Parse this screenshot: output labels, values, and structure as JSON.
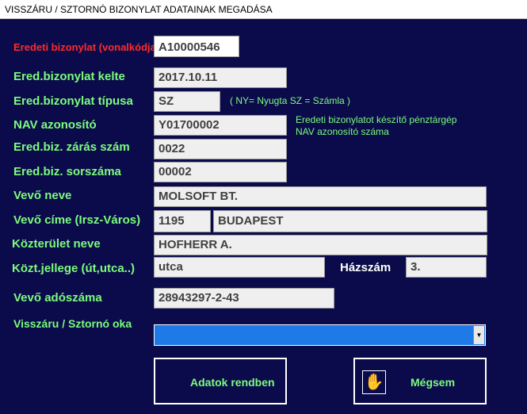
{
  "window": {
    "title": "VISSZÁRU / SZTORNÓ  BIZONYLAT ADATAINAK MEGADÁSA"
  },
  "colors": {
    "background": "#0b0b4b",
    "label": "#7cfc7c",
    "accent_red": "#ff2a2a",
    "select_fill": "#1e7ae6"
  },
  "form": {
    "original_barcode": {
      "label": "Eredeti bizonylat (vonalkódja:)",
      "value": "A10000546"
    },
    "original_date": {
      "label": "Ered.bizonylat kelte",
      "value": "2017.10.11"
    },
    "original_type": {
      "label": "Ered.bizonylat típusa",
      "value": "SZ",
      "hint": "( NY= Nyugta   SZ = Számla )"
    },
    "nav_id": {
      "label": "NAV azonosító",
      "value": "Y01700002",
      "note_line1": "Eredeti bizonylatot készítő pénztárgép",
      "note_line2": "NAV azonosító száma"
    },
    "closing_number": {
      "label": "Ered.biz. zárás szám",
      "value": "0022"
    },
    "serial_number": {
      "label": "Ered.biz. sorszáma",
      "value": "00002"
    },
    "buyer_name": {
      "label": "Vevő neve",
      "value": "MOLSOFT BT."
    },
    "buyer_address": {
      "label": "Vevő címe (Irsz-Város)",
      "zip": "1195",
      "city": "BUDAPEST"
    },
    "street_name": {
      "label": "Közterület neve",
      "value": "HOFHERR A."
    },
    "street_type": {
      "label": "Közt.jellege (út,utca..)",
      "value": "utca"
    },
    "house_number": {
      "label": "Házszám",
      "value": "3."
    },
    "tax_number": {
      "label": "Vevő adószáma",
      "value": "28943297-2-43"
    },
    "reason": {
      "label": "Visszáru / Sztornó oka",
      "value": ""
    }
  },
  "buttons": {
    "ok": {
      "label": "Adatok rendben"
    },
    "cancel": {
      "label": "Mégsem",
      "icon": "hand-icon"
    }
  }
}
